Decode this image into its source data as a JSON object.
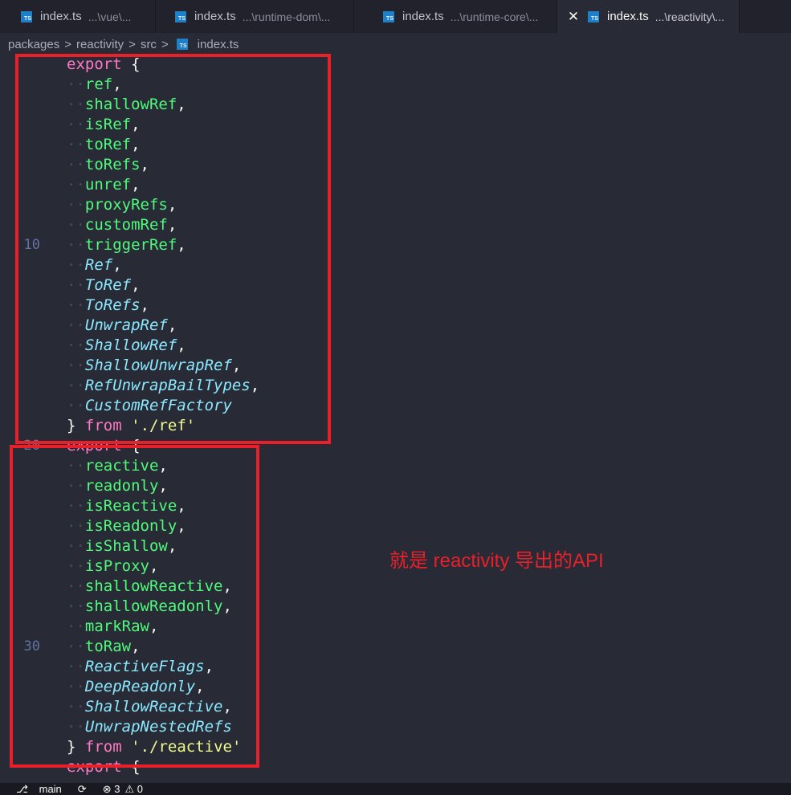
{
  "tabs": [
    {
      "name": "index.ts",
      "desc": "...\\vue\\..."
    },
    {
      "name": "index.ts",
      "desc": "...\\runtime-dom\\..."
    },
    {
      "name": "index.ts",
      "desc": "...\\runtime-core\\..."
    },
    {
      "name": "index.ts",
      "desc": "...\\reactivity\\...",
      "close": "✕"
    }
  ],
  "breadcrumb": {
    "items": [
      "packages",
      "reactivity",
      "src"
    ],
    "file": "index.ts",
    "separator": ">"
  },
  "editor": {
    "line_numbers": {
      "first": "10",
      "second": "20",
      "third": "30"
    },
    "block1": {
      "open_kw": "export",
      "open_brace": "{",
      "items": [
        {
          "name": "ref",
          "kind": "fn"
        },
        {
          "name": "shallowRef",
          "kind": "fn"
        },
        {
          "name": "isRef",
          "kind": "fn"
        },
        {
          "name": "toRef",
          "kind": "fn"
        },
        {
          "name": "toRefs",
          "kind": "fn"
        },
        {
          "name": "unref",
          "kind": "fn"
        },
        {
          "name": "proxyRefs",
          "kind": "fn"
        },
        {
          "name": "customRef",
          "kind": "fn"
        },
        {
          "name": "triggerRef",
          "kind": "fn"
        },
        {
          "name": "Ref",
          "kind": "type"
        },
        {
          "name": "ToRef",
          "kind": "type"
        },
        {
          "name": "ToRefs",
          "kind": "type"
        },
        {
          "name": "UnwrapRef",
          "kind": "type"
        },
        {
          "name": "ShallowRef",
          "kind": "type"
        },
        {
          "name": "ShallowUnwrapRef",
          "kind": "type"
        },
        {
          "name": "RefUnwrapBailTypes",
          "kind": "type"
        },
        {
          "name": "CustomRefFactory",
          "kind": "type"
        }
      ],
      "close_brace": "}",
      "from_kw": "from",
      "source": "'./ref'"
    },
    "block2": {
      "open_kw": "export",
      "open_brace": "{",
      "items": [
        {
          "name": "reactive",
          "kind": "fn"
        },
        {
          "name": "readonly",
          "kind": "fn"
        },
        {
          "name": "isReactive",
          "kind": "fn"
        },
        {
          "name": "isReadonly",
          "kind": "fn"
        },
        {
          "name": "isShallow",
          "kind": "fn"
        },
        {
          "name": "isProxy",
          "kind": "fn"
        },
        {
          "name": "shallowReactive",
          "kind": "fn"
        },
        {
          "name": "shallowReadonly",
          "kind": "fn"
        },
        {
          "name": "markRaw",
          "kind": "fn"
        },
        {
          "name": "toRaw",
          "kind": "fn"
        },
        {
          "name": "ReactiveFlags",
          "kind": "type"
        },
        {
          "name": "DeepReadonly",
          "kind": "type"
        },
        {
          "name": "ShallowReactive",
          "kind": "type"
        },
        {
          "name": "UnwrapNestedRefs",
          "kind": "type"
        }
      ],
      "close_brace": "}",
      "from_kw": "from",
      "source": "'./reactive'"
    },
    "block3": {
      "open_kw": "export",
      "open_brace": "{"
    }
  },
  "annotation": "就是 reactivity 导出的API",
  "statusbar": {
    "branch": "main",
    "sync": "⟳",
    "errors": "⊗ 3",
    "warnings": "⚠ 0"
  },
  "colors": {
    "highlight": "#e8202a",
    "keyword": "#ff79c6",
    "function": "#50fa7b",
    "type": "#8be9fd",
    "string": "#f1fa8c"
  }
}
